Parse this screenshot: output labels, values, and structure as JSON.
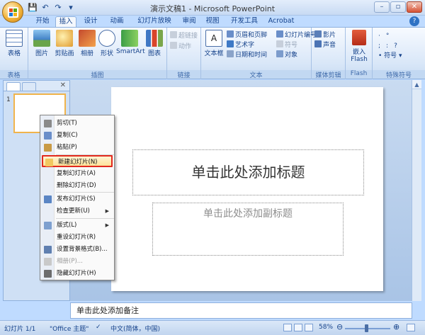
{
  "window": {
    "title": "演示文稿1 - Microsoft PowerPoint"
  },
  "quick_access": {
    "save": "💾",
    "undo": "↶",
    "redo": "↷",
    "more": "▾"
  },
  "window_controls": {
    "minimize": "–",
    "maximize": "▫",
    "close": "✕"
  },
  "tabs": [
    "开始",
    "插入",
    "设计",
    "动画",
    "幻灯片放映",
    "审阅",
    "视图",
    "开发工具",
    "Acrobat"
  ],
  "active_tab": "插入",
  "help": "?",
  "ribbon": {
    "table_group": {
      "name": "表格",
      "table": "表格"
    },
    "illustrations_group": {
      "name": "插图",
      "picture": "图片",
      "clipart": "剪贴画",
      "album": "相册",
      "shapes": "形状",
      "smartart": "SmartArt",
      "chart": "图表"
    },
    "links_group": {
      "name": "链接",
      "hyperlink": "超链接",
      "action": "动作"
    },
    "text_group": {
      "name": "文本",
      "textbox": "文本框",
      "header_footer": "页眉和页脚",
      "wordart": "艺术字",
      "datetime": "日期和时间",
      "slide_number": "幻灯片编号",
      "symbol": "符号",
      "object": "对象"
    },
    "media_group": {
      "name": "媒体剪辑",
      "movie": "影片",
      "sound": "声音"
    },
    "flash_group": {
      "name": "Flash",
      "insert_flash": "嵌入 Flash"
    },
    "special_group": {
      "name": "特殊符号",
      "symbols_label": "符号"
    }
  },
  "slide_pane": {
    "thumb_number": "1",
    "close": "✕"
  },
  "slide": {
    "title_placeholder": "单击此处添加标题",
    "subtitle_placeholder": "单击此处添加副标题"
  },
  "notes": {
    "placeholder": "单击此处添加备注"
  },
  "statusbar": {
    "slide_info": "幻灯片 1/1",
    "theme": "\"Office 主题\"",
    "language": "中文(简体，中国)",
    "zoom": "58%",
    "zoom_out": "⊖",
    "zoom_in": "⊕"
  },
  "context_menu": {
    "items": [
      {
        "label": "剪切(T)",
        "disabled": false
      },
      {
        "label": "复制(C)",
        "disabled": false
      },
      {
        "label": "粘贴(P)",
        "disabled": false
      },
      {
        "label": "新建幻灯片(N)",
        "disabled": false,
        "highlighted": true
      },
      {
        "label": "复制幻灯片(A)",
        "disabled": false
      },
      {
        "label": "删除幻灯片(D)",
        "disabled": false
      },
      {
        "label": "发布幻灯片(S)",
        "disabled": false
      },
      {
        "label": "检查更新(U)",
        "disabled": false,
        "submenu": true
      },
      {
        "label": "版式(L)",
        "disabled": false,
        "submenu": true
      },
      {
        "label": "重设幻灯片(R)",
        "disabled": false
      },
      {
        "label": "设置背景格式(B)...",
        "disabled": false
      },
      {
        "label": "相册(P)...",
        "disabled": true
      },
      {
        "label": "隐藏幻灯片(H)",
        "disabled": false
      }
    ]
  },
  "colors": {
    "accent": "#15428b",
    "highlight_border": "#e2291e",
    "ribbon_bg": "#dbe7f8"
  }
}
